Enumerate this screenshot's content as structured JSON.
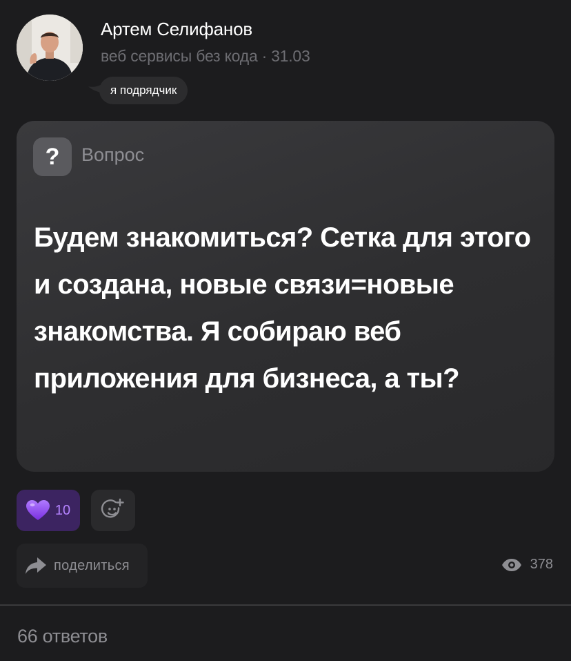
{
  "author": {
    "name": "Артем Селифанов",
    "subtitle": "веб сервисы без кода",
    "separator": "·",
    "date": "31.03",
    "role_tag": "я подрядчик"
  },
  "post": {
    "type_icon": "?",
    "type_label": "Вопрос",
    "text": "Будем знакомиться? Сетка для этого и создана, новые связи=новые знакомства. Я собираю веб приложения для бизнеса, а ты?"
  },
  "reactions": {
    "items": [
      {
        "icon": "purple-heart-icon",
        "count": "10",
        "color": "#8e44ff"
      }
    ],
    "add_icon": "add-emoji-icon"
  },
  "actions": {
    "share_label": "поделиться",
    "share_icon": "share-arrow-icon",
    "views_icon": "eye-icon",
    "views_count": "378"
  },
  "replies_label": "66 ответов",
  "colors": {
    "background": "#1c1c1e",
    "accent": "#b583ff",
    "muted": "#8e8e93"
  }
}
